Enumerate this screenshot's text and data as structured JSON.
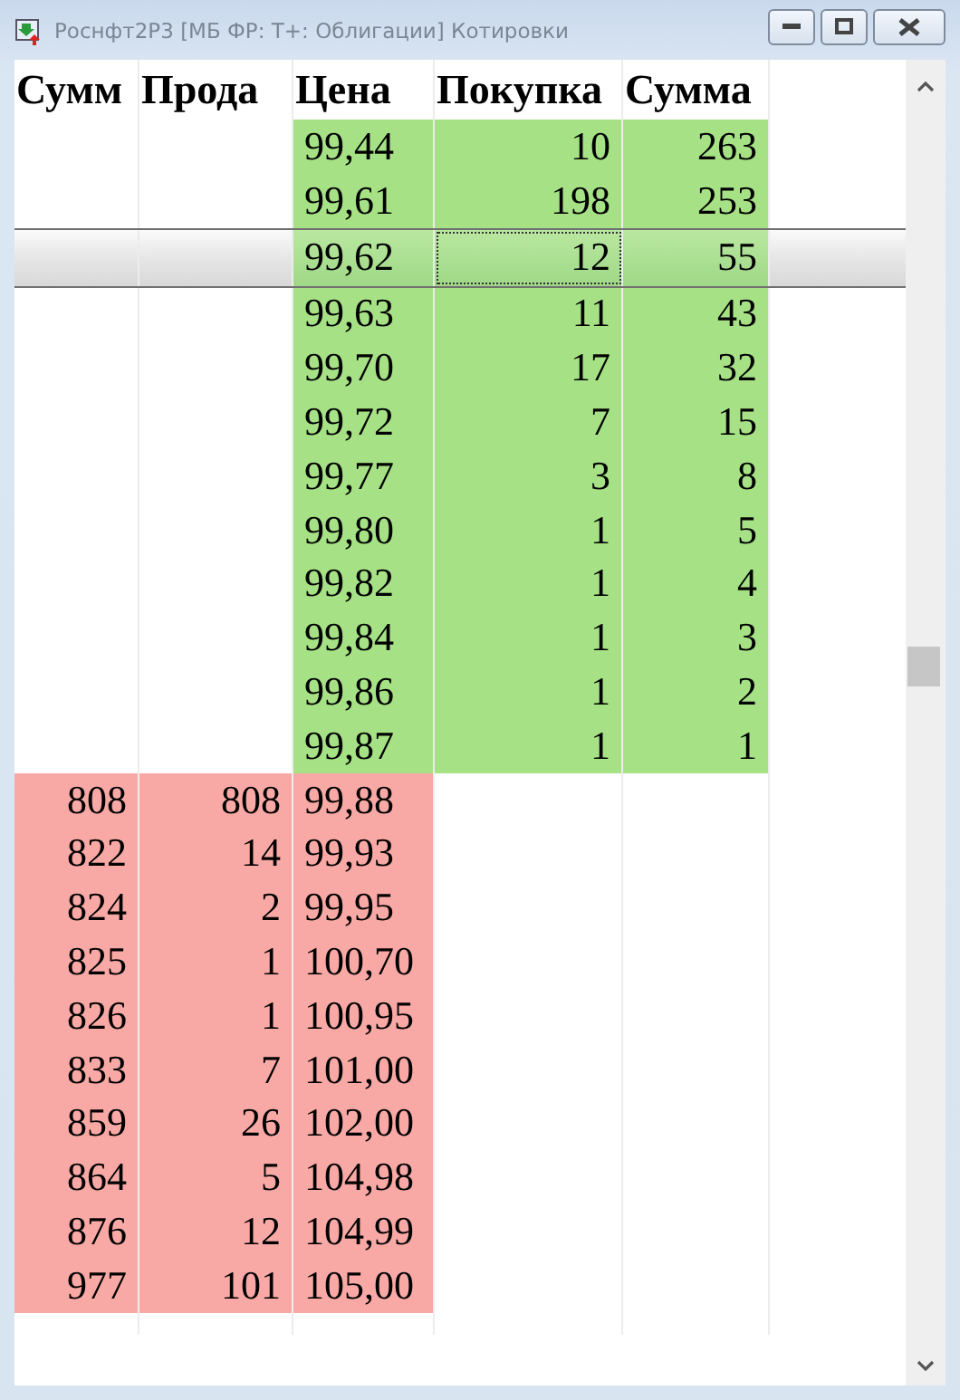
{
  "window": {
    "title": "Роснфт2Р3 [МБ ФР: Т+: Облигации] Котировки"
  },
  "columns": [
    "Сумм",
    "Прода",
    "Цена",
    "Покупка",
    "Сумма"
  ],
  "rows": [
    {
      "kind": "bid",
      "price": "99,44",
      "buy": "10",
      "sum": "263",
      "selected": false
    },
    {
      "kind": "bid",
      "price": "99,61",
      "buy": "198",
      "sum": "253",
      "selected": false
    },
    {
      "kind": "bid",
      "price": "99,62",
      "buy": "12",
      "sum": "55",
      "selected": true
    },
    {
      "kind": "bid",
      "price": "99,63",
      "buy": "11",
      "sum": "43",
      "selected": false
    },
    {
      "kind": "bid",
      "price": "99,70",
      "buy": "17",
      "sum": "32",
      "selected": false
    },
    {
      "kind": "bid",
      "price": "99,72",
      "buy": "7",
      "sum": "15",
      "selected": false
    },
    {
      "kind": "bid",
      "price": "99,77",
      "buy": "3",
      "sum": "8",
      "selected": false
    },
    {
      "kind": "bid",
      "price": "99,80",
      "buy": "1",
      "sum": "5",
      "selected": false
    },
    {
      "kind": "bid",
      "price": "99,82",
      "buy": "1",
      "sum": "4",
      "selected": false
    },
    {
      "kind": "bid",
      "price": "99,84",
      "buy": "1",
      "sum": "3",
      "selected": false
    },
    {
      "kind": "bid",
      "price": "99,86",
      "buy": "1",
      "sum": "2",
      "selected": false
    },
    {
      "kind": "bid",
      "price": "99,87",
      "buy": "1",
      "sum": "1",
      "selected": false
    },
    {
      "kind": "ask",
      "sum": "808",
      "sell": "808",
      "price": "99,88",
      "selected": false
    },
    {
      "kind": "ask",
      "sum": "822",
      "sell": "14",
      "price": "99,93",
      "selected": false
    },
    {
      "kind": "ask",
      "sum": "824",
      "sell": "2",
      "price": "99,95",
      "selected": false
    },
    {
      "kind": "ask",
      "sum": "825",
      "sell": "1",
      "price": "100,70",
      "selected": false
    },
    {
      "kind": "ask",
      "sum": "826",
      "sell": "1",
      "price": "100,95",
      "selected": false
    },
    {
      "kind": "ask",
      "sum": "833",
      "sell": "7",
      "price": "101,00",
      "selected": false
    },
    {
      "kind": "ask",
      "sum": "859",
      "sell": "26",
      "price": "102,00",
      "selected": false
    },
    {
      "kind": "ask",
      "sum": "864",
      "sell": "5",
      "price": "104,98",
      "selected": false
    },
    {
      "kind": "ask",
      "sum": "876",
      "sell": "12",
      "price": "104,99",
      "selected": false
    },
    {
      "kind": "ask",
      "sum": "977",
      "sell": "101",
      "price": "105,00",
      "selected": false
    }
  ]
}
